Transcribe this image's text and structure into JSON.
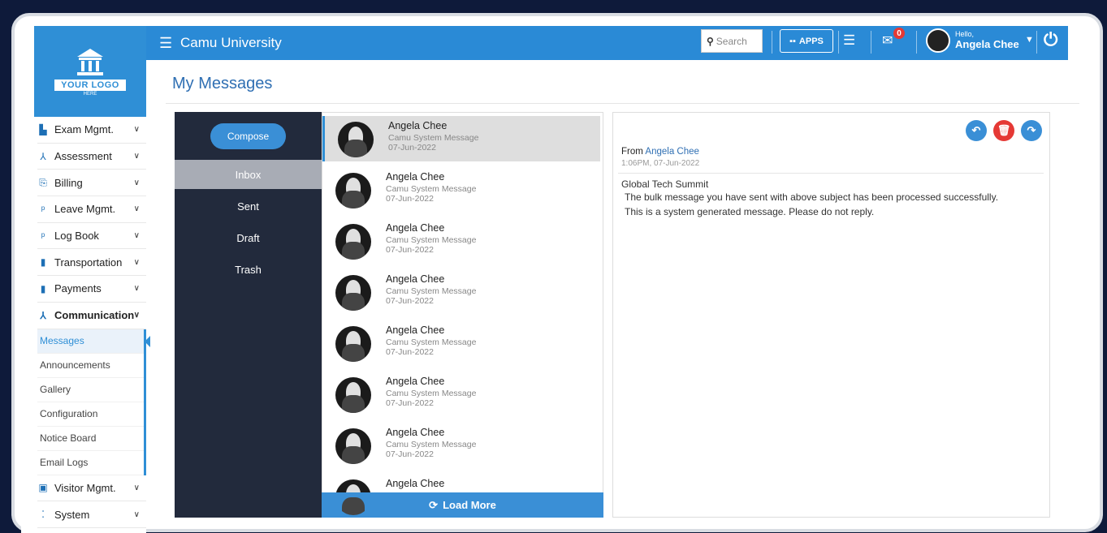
{
  "colors": {
    "accent": "#2a8ad6",
    "sidebar_dark": "#222a3c",
    "danger": "#e53935"
  },
  "logo": {
    "line1": "YOUR LOGO",
    "line2": "HERE"
  },
  "topbar": {
    "title": "Camu University",
    "search_placeholder": "Search",
    "apps_label": "APPS",
    "mail_badge": "0",
    "hello": "Hello,",
    "user_name": "Angela Chee"
  },
  "sidebar": {
    "items": [
      {
        "label": "Exam Mgmt.",
        "icon": "exam-icon"
      },
      {
        "label": "Assessment",
        "icon": "assessment-icon"
      },
      {
        "label": "Billing",
        "icon": "billing-icon"
      },
      {
        "label": "Leave Mgmt.",
        "icon": "leave-icon"
      },
      {
        "label": "Log Book",
        "icon": "logbook-icon"
      },
      {
        "label": "Transportation",
        "icon": "transport-icon"
      },
      {
        "label": "Payments",
        "icon": "payments-icon"
      },
      {
        "label": "Communication",
        "icon": "communication-icon"
      }
    ],
    "sub_items": [
      "Messages",
      "Announcements",
      "Gallery",
      "Configuration",
      "Notice Board",
      "Email Logs"
    ],
    "after_items": [
      {
        "label": "Visitor Mgmt.",
        "icon": "visitor-icon"
      },
      {
        "label": "System",
        "icon": "system-icon"
      }
    ]
  },
  "page": {
    "title": "My Messages"
  },
  "folders": {
    "compose": "Compose",
    "items": [
      "Inbox",
      "Sent",
      "Draft",
      "Trash"
    ]
  },
  "messages": [
    {
      "name": "Angela Chee",
      "subject": "Camu System Message",
      "date": "07-Jun-2022"
    },
    {
      "name": "Angela Chee",
      "subject": "Camu System Message",
      "date": "07-Jun-2022"
    },
    {
      "name": "Angela Chee",
      "subject": "Camu System Message",
      "date": "07-Jun-2022"
    },
    {
      "name": "Angela Chee",
      "subject": "Camu System Message",
      "date": "07-Jun-2022"
    },
    {
      "name": "Angela Chee",
      "subject": "Camu System Message",
      "date": "07-Jun-2022"
    },
    {
      "name": "Angela Chee",
      "subject": "Camu System Message",
      "date": "07-Jun-2022"
    },
    {
      "name": "Angela Chee",
      "subject": "Camu System Message",
      "date": "07-Jun-2022"
    },
    {
      "name": "Angela Chee",
      "subject": "",
      "date": ""
    }
  ],
  "load_more": "Load More",
  "reader": {
    "from_label": "From",
    "from_name": "Angela Chee",
    "time": "1:06PM, 07-Jun-2022",
    "subject": "Global Tech Summit",
    "body_line1": "The bulk message you have sent with above subject has been processed successfully.",
    "body_line2": "This is a system generated message. Please do not reply."
  }
}
